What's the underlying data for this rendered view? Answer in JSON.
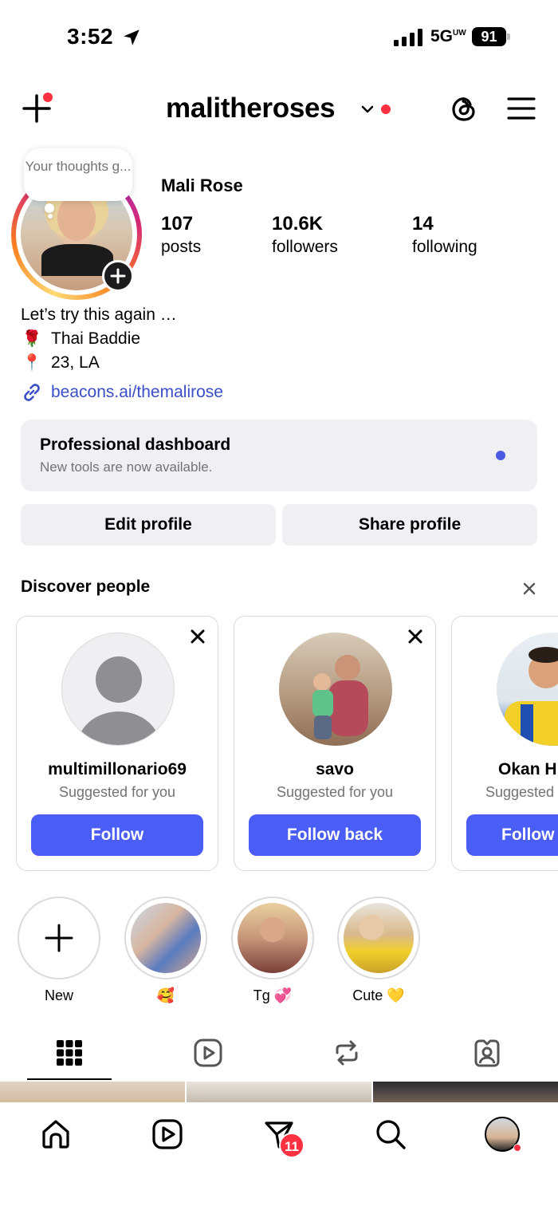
{
  "status_bar": {
    "time": "3:52",
    "network": "5G",
    "network_sup": "UW",
    "battery": "91"
  },
  "header": {
    "username": "malitheroses"
  },
  "profile": {
    "note": "Your thoughts g...",
    "display_name": "Mali Rose",
    "stats": [
      {
        "value": "107",
        "label": "posts"
      },
      {
        "value": "10.6K",
        "label": "followers"
      },
      {
        "value": "14",
        "label": "following"
      }
    ],
    "bio": [
      {
        "emoji": "",
        "text": "Let’s try this again …"
      },
      {
        "emoji": "🌹",
        "text": "Thai Baddie"
      },
      {
        "emoji": "📍",
        "text": "23, LA"
      }
    ],
    "link": "beacons.ai/themalirose"
  },
  "dashboard": {
    "title": "Professional dashboard",
    "subtitle": "New tools are now available."
  },
  "actions": {
    "edit": "Edit profile",
    "share": "Share profile"
  },
  "discover": {
    "title": "Discover people",
    "cards": [
      {
        "name": "multimillonario69",
        "sub": "Suggested for you",
        "button": "Follow"
      },
      {
        "name": "savo",
        "sub": "Suggested for you",
        "button": "Follow back"
      },
      {
        "name": "Okan H",
        "sub": "Suggested",
        "button": "Follow"
      }
    ]
  },
  "highlights": [
    {
      "label": "New"
    },
    {
      "label": "🥰"
    },
    {
      "label": "Tg 💞"
    },
    {
      "label": "Cute 💛"
    }
  ],
  "bottom_nav": {
    "badge": "11"
  },
  "colors": {
    "accent": "#4a5df5",
    "link": "#3a4ec5",
    "notification": "#ff3040"
  }
}
